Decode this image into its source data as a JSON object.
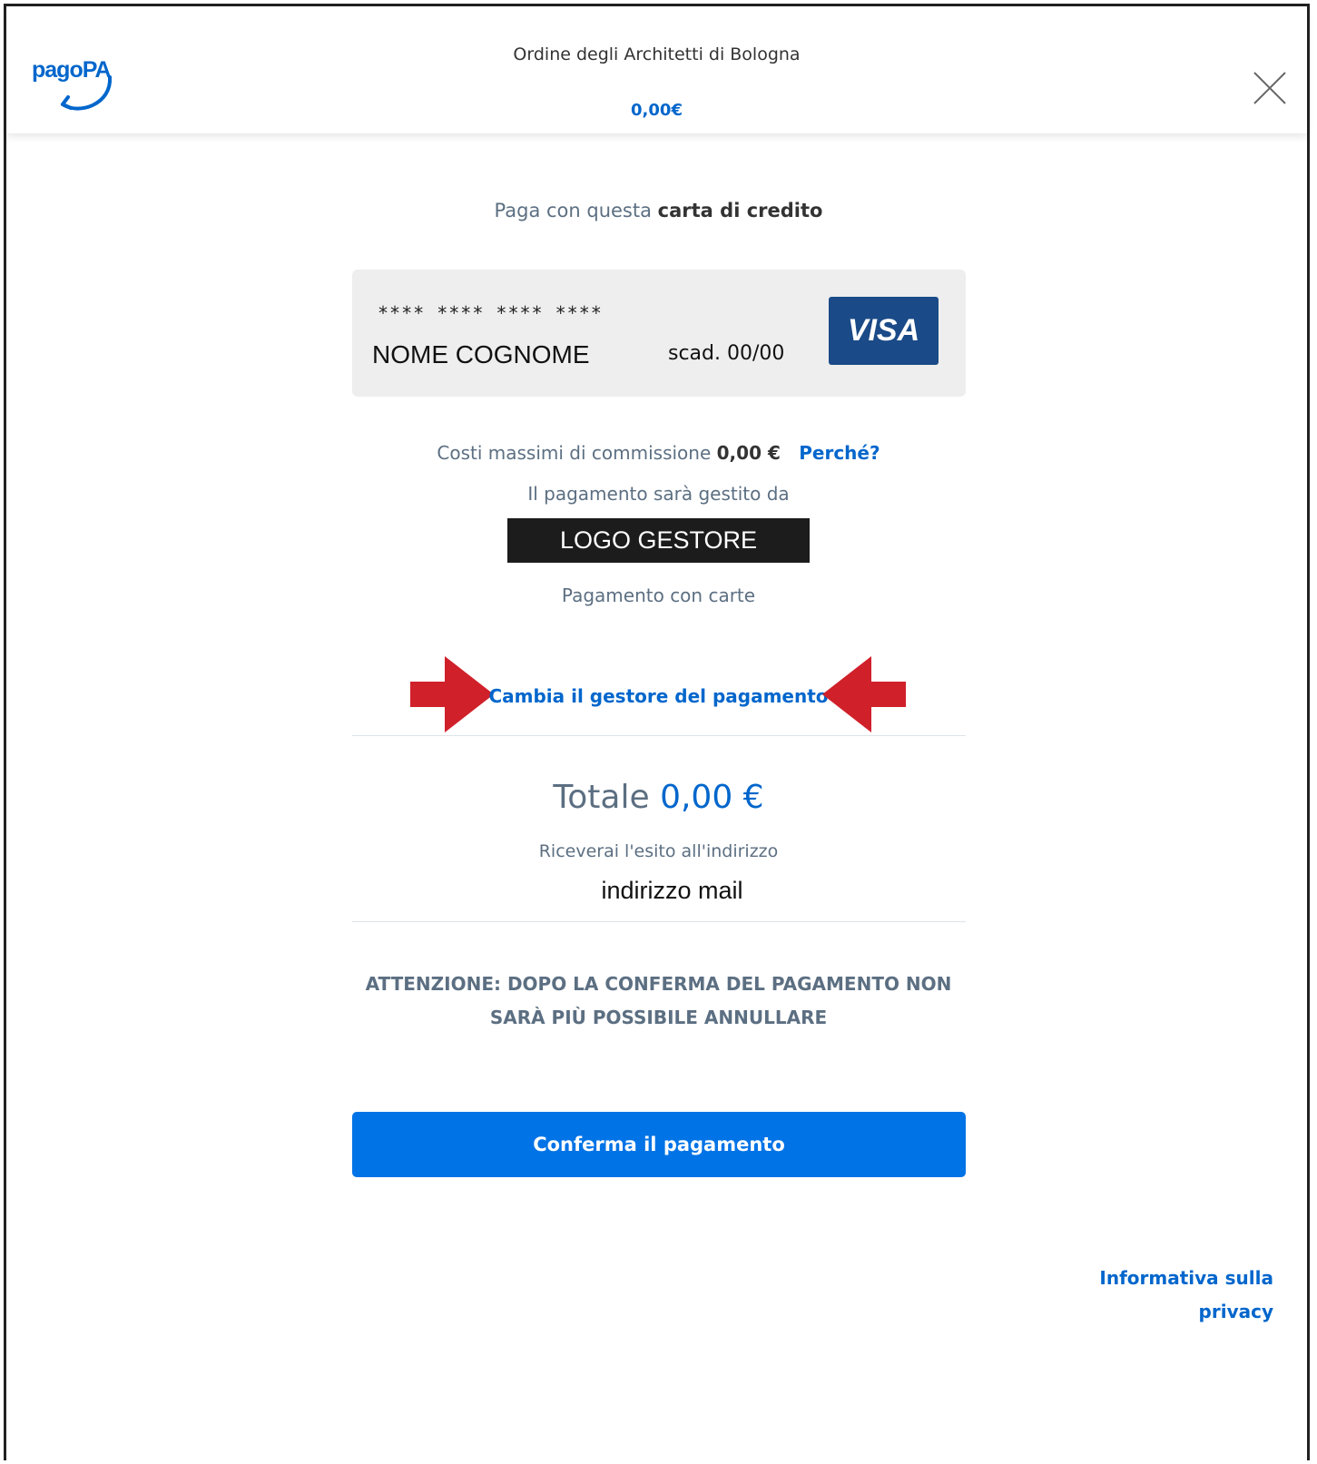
{
  "header": {
    "logo_text": "pagoPA",
    "organization": "Ordine degli Architetti di Bologna",
    "amount": "0,00€"
  },
  "intro": {
    "prefix": "Paga con questa",
    "emphasis": "carta di credito"
  },
  "card": {
    "number": "**** **** **** ****",
    "holder": "NOME COGNOME",
    "expiry": "scad. 00/00",
    "brand": "VISA",
    "brand_color": "#1a4a87"
  },
  "fees": {
    "label": "Costi massimi di commissione",
    "value": "0,00 €",
    "why_link": "Perché?"
  },
  "manager": {
    "label": "Il pagamento sarà gestito da",
    "logo": "LOGO GESTORE",
    "method": "Pagamento con carte",
    "change_link": "Cambia il gestore del pagamento"
  },
  "annotation": {
    "arrow_color": "#d0202a"
  },
  "total": {
    "label": "Totale",
    "value": "0,00 €",
    "receive_label": "Riceverai l'esito all'indirizzo",
    "email": "indirizzo mail"
  },
  "warning": {
    "line1": "ATTENZIONE: DOPO LA CONFERMA DEL PAGAMENTO NON",
    "line2": "SARÀ PIÙ POSSIBILE ANNULLARE"
  },
  "confirm_button": "Conferma il pagamento",
  "privacy": {
    "line1": "Informativa sulla",
    "line2": "privacy"
  },
  "colors": {
    "accent": "#0066cc",
    "button": "#0073e6",
    "text": "#5c6f82"
  }
}
